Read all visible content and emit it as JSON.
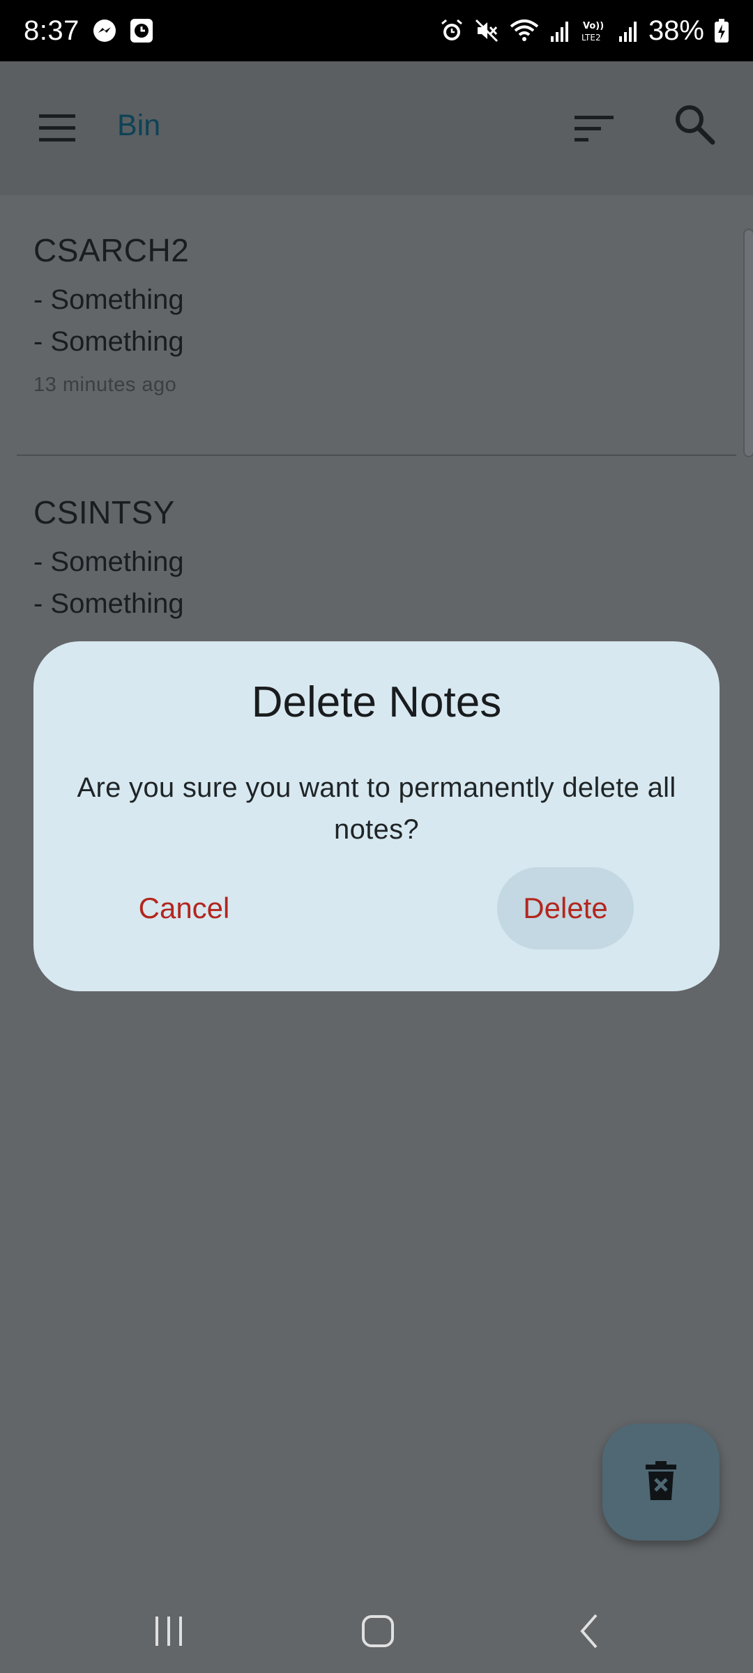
{
  "status_bar": {
    "time": "8:37",
    "battery_percent": "38%",
    "icons": [
      "messenger-icon",
      "clock-app-icon",
      "alarm-icon",
      "mute-icon",
      "wifi-icon",
      "signal-icon",
      "volte-icon",
      "signal-icon",
      "battery-charging-icon"
    ]
  },
  "app_bar": {
    "title": "Bin",
    "menu_icon": "hamburger-menu-icon",
    "sort_icon": "sort-icon",
    "search_icon": "search-icon"
  },
  "notes": [
    {
      "title": "CSARCH2",
      "lines": [
        "- Something",
        "- Something"
      ],
      "time": "13 minutes ago"
    },
    {
      "title": "CSINTSY",
      "lines": [
        "- Something",
        "- Something"
      ],
      "time": ""
    }
  ],
  "dialog": {
    "title": "Delete Notes",
    "message": "Are you sure you want to permanently delete all notes?",
    "cancel_label": "Cancel",
    "delete_label": "Delete"
  },
  "fab": {
    "icon": "delete-forever-icon"
  },
  "nav_bar": {
    "recents_icon": "recents-icon",
    "home_icon": "home-icon",
    "back_icon": "back-icon"
  },
  "colors": {
    "scrim": "#636669",
    "dialog_bg": "#d7e8f0",
    "danger": "#b3261e",
    "title_accent": "#0e4256"
  }
}
